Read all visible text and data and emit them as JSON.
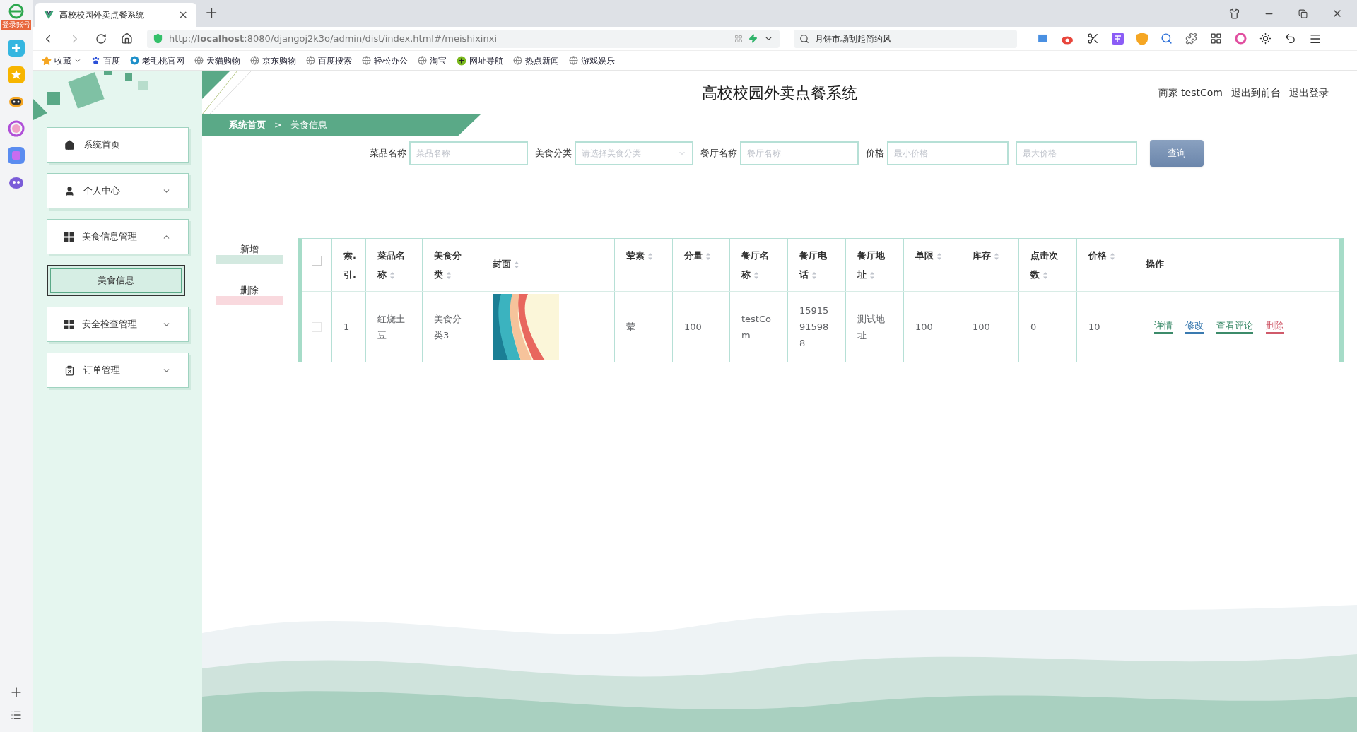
{
  "browser": {
    "side_panel": {
      "badge": "登录账号"
    },
    "tab": {
      "title": "高校校园外卖点餐系统",
      "close": "×"
    },
    "new_tab": "+",
    "address": "http://**localhost**:8080/djangoj2k3o/admin/dist/index.html#/meishixinxi",
    "search": {
      "value": "月饼市场刮起简约风"
    },
    "bookmarks": [
      {
        "label": "收藏",
        "kind": "star"
      },
      {
        "label": "百度",
        "kind": "paw"
      },
      {
        "label": "老毛桃官网",
        "kind": "site"
      },
      {
        "label": "天猫购物",
        "kind": "globe"
      },
      {
        "label": "京东购物",
        "kind": "globe"
      },
      {
        "label": "百度搜索",
        "kind": "globe"
      },
      {
        "label": "轻松办公",
        "kind": "globe"
      },
      {
        "label": "淘宝",
        "kind": "globe"
      },
      {
        "label": "网址导航",
        "kind": "nav"
      },
      {
        "label": "热点新闻",
        "kind": "globe"
      },
      {
        "label": "游戏娱乐",
        "kind": "globe"
      }
    ]
  },
  "app": {
    "title": "高校校园外卖点餐系统",
    "user": "商家 testCom",
    "links": [
      "退出到前台",
      "退出登录"
    ],
    "breadcrumb": {
      "items": [
        "系统首页",
        "美食信息"
      ],
      "separator": ">"
    },
    "menu": [
      {
        "label": "系统首页",
        "kind": "link"
      },
      {
        "label": "个人中心",
        "kind": "group",
        "expanded": false
      },
      {
        "label": "美食信息管理",
        "kind": "group",
        "expanded": true,
        "children": [
          {
            "label": "美食信息",
            "selected": true
          }
        ]
      },
      {
        "label": "安全检查管理",
        "kind": "group",
        "expanded": false
      },
      {
        "label": "订单管理",
        "kind": "group",
        "expanded": false
      }
    ],
    "filters": [
      {
        "label": "菜品名称",
        "fields": [
          {
            "kind": "input",
            "placeholder": "菜品名称"
          }
        ]
      },
      {
        "label": "美食分类",
        "fields": [
          {
            "kind": "select",
            "placeholder": "请选择美食分类"
          }
        ]
      },
      {
        "label": "餐厅名称",
        "fields": [
          {
            "kind": "input",
            "placeholder": "餐厅名称"
          }
        ]
      },
      {
        "label": "价格",
        "fields": [
          {
            "kind": "input",
            "placeholder": "最小价格"
          },
          {
            "kind": "input",
            "placeholder": "最大价格"
          }
        ]
      }
    ],
    "query_button": "查询",
    "actions": [
      {
        "label": "新增",
        "kind": "add"
      },
      {
        "label": "删除",
        "kind": "delete"
      }
    ],
    "table": {
      "header_checked": false,
      "columns": [
        {
          "label": "索.引.",
          "sortable": false
        },
        {
          "label": "菜品名称",
          "sortable": true
        },
        {
          "label": "美食分类",
          "sortable": true
        },
        {
          "label": "封面",
          "sortable": true
        },
        {
          "label": "荤素",
          "sortable": true
        },
        {
          "label": "分量",
          "sortable": true
        },
        {
          "label": "餐厅名称",
          "sortable": true
        },
        {
          "label": "餐厅电话",
          "sortable": true
        },
        {
          "label": "餐厅地址",
          "sortable": true
        },
        {
          "label": "单限",
          "sortable": true
        },
        {
          "label": "库存",
          "sortable": true
        },
        {
          "label": "点击次数",
          "sortable": true
        },
        {
          "label": "价格",
          "sortable": true
        },
        {
          "label": "操作",
          "sortable": false
        }
      ],
      "rows": [
        {
          "checked": false,
          "cells": [
            "1",
            "红烧土豆",
            "美食分类3",
            {
              "kind": "picture"
            },
            "荤",
            "100",
            "testCom",
            "15915915988",
            "测试地址",
            "100",
            "100",
            "0",
            "10"
          ],
          "actions": [
            {
              "label": "详情",
              "kind": "detail"
            },
            {
              "label": "修改",
              "kind": "edit"
            },
            {
              "label": "查看评论",
              "kind": "comments"
            },
            {
              "label": "删除",
              "kind": "delete"
            }
          ]
        }
      ]
    }
  }
}
